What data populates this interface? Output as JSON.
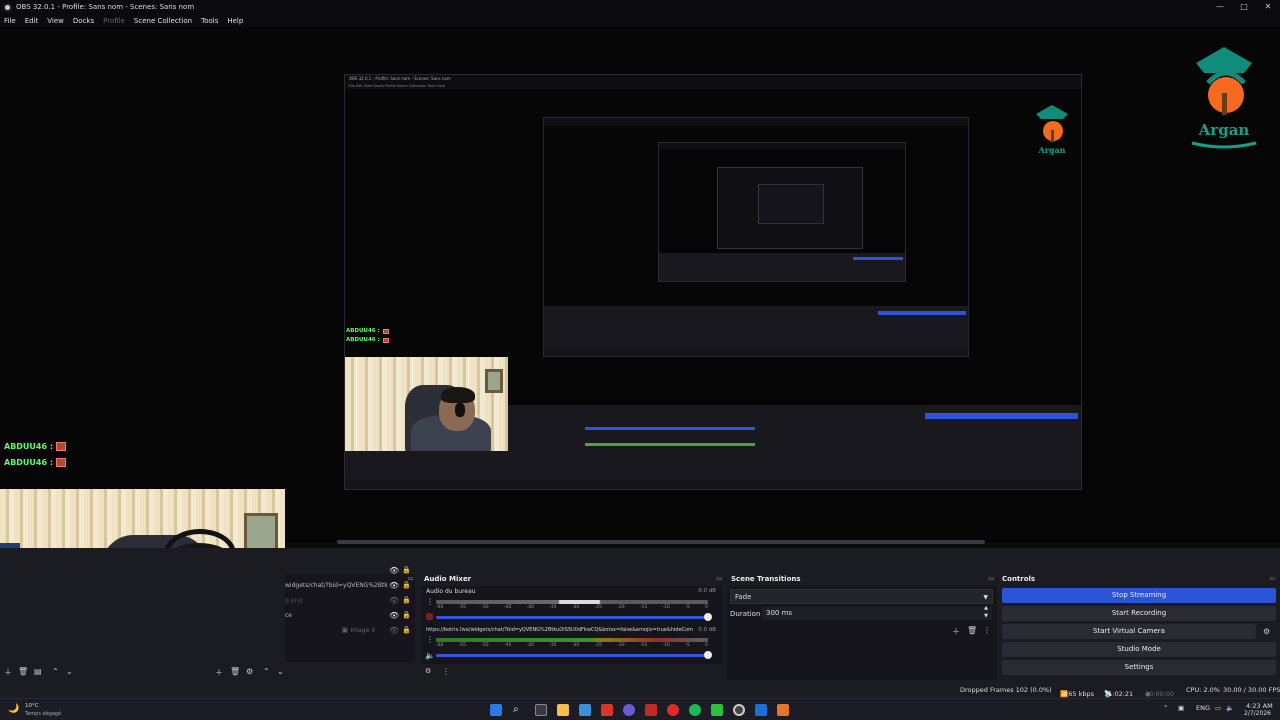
{
  "window": {
    "title": "OBS 32.0.1 - Profile: Sans nom - Scenes: Sans nom",
    "minimize": "—",
    "maximize": "□",
    "close": "✕"
  },
  "menu": {
    "items": [
      "File",
      "Edit",
      "View",
      "Docks",
      "Profile",
      "Scene Collection",
      "Tools",
      "Help"
    ]
  },
  "preview": {
    "chat_lines": [
      "ABDUU46 :",
      "ABDUU46 :"
    ],
    "nested_title": "OBS 32.0.1 - Profile: Sans nom - Scenes: Sans nom",
    "nested_menu": "File  Edit  View  Docks  Profile  Scene Collection  Tools  Help",
    "logo_text": "Argan"
  },
  "sources": {
    "rows": [
      {
        "name": "widgets/chat/?bid=yQVENG%2Btk",
        "eye": "👁",
        "lock": "🔒"
      },
      {
        "name": "",
        "eye": "👁",
        "lock": "🔒"
      },
      {
        "name": "g.png",
        "eye": "👁",
        "lock": "🔒"
      },
      {
        "name": "ce",
        "eye": "👁",
        "lock": "🔒"
      },
      {
        "name": "Image 3",
        "eye": "👁",
        "lock": "🔒"
      }
    ]
  },
  "audio_mixer": {
    "header": "Audio Mixer",
    "channels": [
      {
        "name": "Audio du bureau",
        "db": "0.0 dB",
        "meter_level": 0.88
      },
      {
        "name": "https://botrix.live/widgets/chat/?bid=yQVENG%2BtkuOISSU0dFkwCQ&botsx=false&emojis=true&hideCom",
        "db": "0.0 dB",
        "meter_level": 0.95
      }
    ],
    "ticks": [
      "-60",
      "-55",
      "-50",
      "-45",
      "-40",
      "-35",
      "-30",
      "-25",
      "-20",
      "-15",
      "-10",
      "-5",
      "0"
    ]
  },
  "scene_transitions": {
    "header": "Scene Transitions",
    "transition": "Fade",
    "duration_label": "Duration",
    "duration_value": "300 ms"
  },
  "controls": {
    "header": "Controls",
    "buttons": [
      "Stop Streaming",
      "Start Recording",
      "Start Virtual Camera",
      "Studio Mode",
      "Settings"
    ]
  },
  "status": {
    "dropped_frames": "Dropped Frames 102 (0.0%)",
    "bitrate": "7265 kbps",
    "stream_time": "11:02:21",
    "rec_time": "00:00:00",
    "cpu": "CPU: 2.0%",
    "fps": "30.00 / 30.00 FPS"
  },
  "taskbar": {
    "weather_temp": "10°C",
    "weather_desc": "Temps dégagé",
    "lang": "ENG",
    "time": "4:23 AM",
    "date": "2/7/2026"
  },
  "colors": {
    "accent": "#2d53d8",
    "chat_green": "#5cff5c"
  }
}
